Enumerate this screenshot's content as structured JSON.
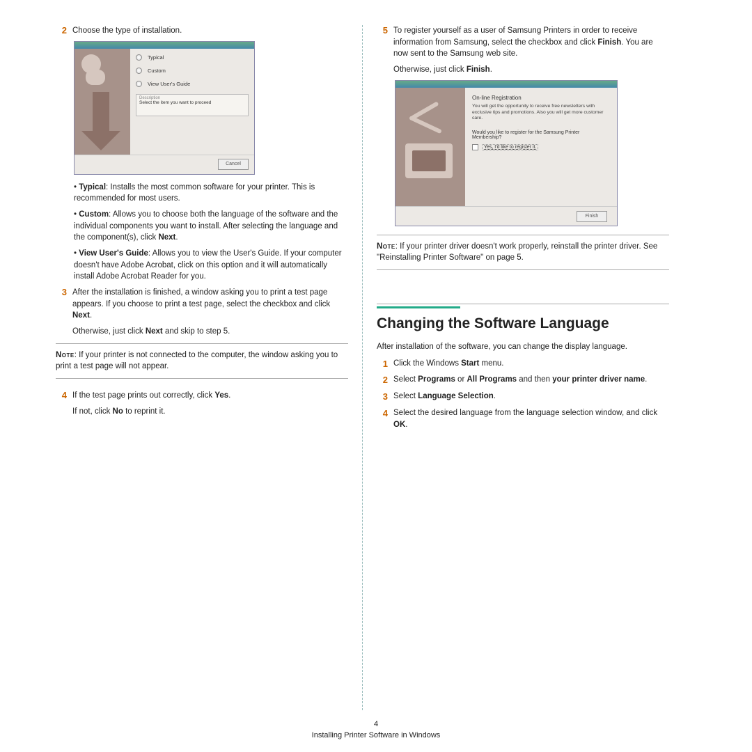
{
  "left": {
    "step2": {
      "num": "2",
      "text": "Choose the type of installation."
    },
    "wizard1": {
      "opt1": "Typical",
      "opt2": "Custom",
      "opt3": "View User's Guide",
      "desc_label": "Description",
      "desc_text": "Select the item you want to proceed",
      "cancel": "Cancel"
    },
    "bullets": {
      "b1_head": "Typical",
      "b1_tail": ": Installs the most common software for your printer. This is recommended for most users.",
      "b2_head": "Custom",
      "b2_tail_a": ": Allows you to choose both the language of the software and the individual components you want to install. After selecting the language and the component(s), click ",
      "b2_tail_b": "Next",
      "b2_tail_c": ".",
      "b3_head": "View User's Guide",
      "b3_tail": ": Allows you to view the User's Guide. If your computer doesn't have Adobe Acrobat, click on this option and it will automatically install Adobe Acrobat Reader for you."
    },
    "step3": {
      "num": "3",
      "text_a": "After the installation is finished, a window asking you to print a test page appears. If you choose to print a test page, select the checkbox and click ",
      "text_b": "Next",
      "text_c": ".",
      "otherwise_a": "Otherwise, just click ",
      "otherwise_b": "Next",
      "otherwise_c": " and skip to step 5."
    },
    "note1": {
      "label": "Note",
      "text": ": If your printer is not connected to the computer, the window asking you to print a test page will not appear."
    },
    "step4": {
      "num": "4",
      "line1_a": "If the test page prints out correctly, click ",
      "line1_b": "Yes",
      "line1_c": ".",
      "line2_a": "If not, click ",
      "line2_b": "No",
      "line2_c": " to reprint it."
    }
  },
  "right": {
    "step5": {
      "num": "5",
      "text_a": "To register yourself as a user of Samsung Printers in order to receive information from Samsung, select the checkbox and click ",
      "text_b": "Finish",
      "text_c": ". You are now sent to the Samsung web site.",
      "otherwise_a": "Otherwise, just click ",
      "otherwise_b": "Finish",
      "otherwise_c": "."
    },
    "wizard2": {
      "reg_title": "On-line Registration",
      "reg_text": "You will get the opportunity to receive free newsletters with exclusive tips and promotions. Also you will get more customer care.",
      "question": "Would you like to register for the Samsung Printer Membership?",
      "checkbox_label": "Yes, I'd like to register it.",
      "finish": "Finish"
    },
    "note2": {
      "label": "Note",
      "text": ": If your printer driver doesn't work properly, reinstall the printer driver. See \"Reinstalling Printer Software\" on page 5."
    },
    "section": {
      "title": "Changing the Software Language",
      "intro": "After installation of the software, you can change the display language.",
      "s1": {
        "n": "1",
        "a": "Click the Windows ",
        "b": "Start",
        "c": " menu."
      },
      "s2": {
        "n": "2",
        "a": "Select ",
        "b": "Programs",
        "c": " or ",
        "d": "All Programs",
        "e": " and then ",
        "f": "your printer driver name",
        "g": "."
      },
      "s3": {
        "n": "3",
        "a": "Select ",
        "b": "Language Selection",
        "c": "."
      },
      "s4": {
        "n": "4",
        "a": "Select the desired language from the language selection window, and click ",
        "b": "OK",
        "c": "."
      }
    }
  },
  "footer": {
    "page_num": "4",
    "chapter": "Installing Printer Software in Windows"
  }
}
